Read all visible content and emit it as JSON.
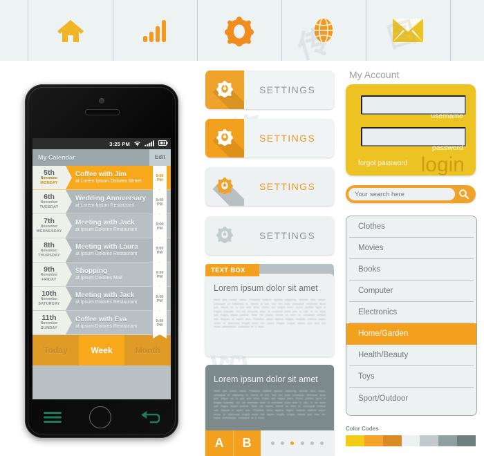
{
  "iconbar": {
    "icons": [
      {
        "name": "home-icon",
        "label": "Home",
        "color": "#f2b422"
      },
      {
        "name": "signal-bars-icon",
        "label": "Signal",
        "color": "#f09a20"
      },
      {
        "name": "gear-icon",
        "label": "Settings",
        "color": "#f18d1d"
      },
      {
        "name": "globe-icon",
        "label": "Globe",
        "color": "#f09a20"
      },
      {
        "name": "envelope-icon",
        "label": "Mail",
        "color": "#edc324"
      }
    ]
  },
  "phone": {
    "statusbar": {
      "time": "3:25 PM",
      "wifi": "wifi-icon",
      "signal": "signal-icon",
      "battery": "battery-icon"
    },
    "header": {
      "title": "My Calendar",
      "edit": "Edit"
    },
    "events": [
      {
        "day": "5th",
        "month": "November",
        "weekday": "MONDAY",
        "title": "Coffee with Jim",
        "place": "at Lorem Ipsum Dolores Street",
        "time1": "9:00",
        "time2": "PM",
        "state": "active"
      },
      {
        "day": "6th",
        "month": "November",
        "weekday": "TUESDAY",
        "title": "Wedding Anniversary",
        "place": "at Lorem Ipsum Restaurant",
        "time1": "9:00",
        "time2": "PM",
        "state": "alt"
      },
      {
        "day": "7th",
        "month": "November",
        "weekday": "WEDNESDAY",
        "title": "Meeting with Jack",
        "place": "at Ipsum Dolores Restaurant",
        "time1": "9:00",
        "time2": "PM",
        "state": "normal"
      },
      {
        "day": "8th",
        "month": "November",
        "weekday": "THURSDAY",
        "title": "Meeting with Laura",
        "place": "at Ipsum Dolores Restaurant",
        "time1": "9:00",
        "time2": "PM",
        "state": "alt"
      },
      {
        "day": "9th",
        "month": "November",
        "weekday": "FRIDAY",
        "title": "Shopping",
        "place": "at Ipsum Dolores Mall",
        "time1": "9:00",
        "time2": "PM",
        "state": "normal"
      },
      {
        "day": "10th",
        "month": "November",
        "weekday": "SATURDAY",
        "title": "Meeting with Jack",
        "place": "at Ipsum Dolores Restaurant",
        "time1": "9:00",
        "time2": "PM",
        "state": "alt"
      },
      {
        "day": "11th",
        "month": "November",
        "weekday": "SUNDAY",
        "title": "Coffee with Eva",
        "place": "at Ipsum Dolores Restaurant",
        "time1": "9:00",
        "time2": "PM",
        "state": "normal"
      }
    ],
    "segments": [
      {
        "label": "Today",
        "selected": false
      },
      {
        "label": "Week",
        "selected": true
      },
      {
        "label": "Month",
        "selected": false
      }
    ],
    "bottom": {
      "menu": "hamburger-menu-icon",
      "home": "home-button",
      "back": "back-arrow-icon"
    }
  },
  "settings_buttons": [
    {
      "label": "SETTINGS",
      "variant": "v1",
      "icon": "gear-icon"
    },
    {
      "label": "SETTINGS",
      "variant": "v2",
      "icon": "gear-icon"
    },
    {
      "label": "SETTINGS",
      "variant": "v3",
      "icon": "gear-icon"
    },
    {
      "label": "SETTINGS",
      "variant": "v4",
      "icon": "gear-icon"
    }
  ],
  "textbox": {
    "tab_label": "TEXT BOX",
    "heading": "Lorem ipsum dolor sit amet",
    "body": "Morbi quis cursus metus. Phasellus eleifend egestas adipiscing. Aenean risus neque, consequat eu adipiscing et, viverra at orci. Sed non justo consequat, bibendum lacus quis, aliquet mi. In quis ante tellus. Donec sed magna lorem. Donec porttitor ligula ut fringilla vulputate, orci est venenatis dolor, id commodo lorem ante ut odio. In vel turpis quis magna aliquet pulvinar. Nulla nisl mauris, blandit eu enim et, consequat tristique velit. Aliquam et sapien arcu. Phasellus varius dapibus magna, molestie eleifend sapien ornare at. Maecenas fringilla luctus non sapien fringilla congue. Mauris quis risus nec metus pellentesque consequat at a turpis."
  },
  "graycard": {
    "heading": "Lorem ipsum dolor sit amet",
    "body": "Morbi quis cursus metus. Phasellus eleifend egestas adipiscing. Aenean risus neque, consequat eu adipiscing et, viverra at orci. Sed non justo consequat, bibendum lacus quis, aliquet mi. In quis ante tellus. Donec sed magna lorem. Donec porttitor ligula ut fringilla vulputate, orci est venenatis dolor, id commodo lorem ante ut odio. In vel turpis quis magna aliquet pulvinar. Nulla nisl mauris, blandit eu enim et, consequat tristique velit. Aliquam et sapien arcu. Phasellus varius dapibus magna, molestie eleifend sapien ornare at. Maecenas fringilla luctus non sapien fringilla congue. Mauris quis risus nec metus pellentesque consequat at a turpis.",
    "button_a": "A",
    "button_b": "B",
    "dots": 6,
    "active_dot": 3
  },
  "account": {
    "title": "My Account",
    "username_value": "",
    "username_caption": "username",
    "password_value": "",
    "password_caption": "password",
    "forgot": "forgot password",
    "login": "login"
  },
  "search": {
    "placeholder": "Your search here",
    "value": "",
    "icon": "search-icon"
  },
  "categories": {
    "items": [
      {
        "label": "Clothes",
        "selected": false
      },
      {
        "label": "Movies",
        "selected": false
      },
      {
        "label": "Books",
        "selected": false
      },
      {
        "label": "Computer",
        "selected": false
      },
      {
        "label": "Electronics",
        "selected": false
      },
      {
        "label": "Home/Garden",
        "selected": true
      },
      {
        "label": "Health/Beauty",
        "selected": false
      },
      {
        "label": "Toys",
        "selected": false
      },
      {
        "label": "Sport/Outdoor",
        "selected": false
      }
    ]
  },
  "color_codes": {
    "title": "Color Codes",
    "swatches": [
      "#f2cd16",
      "#f4a22a",
      "#d98a25",
      "#eef1f2",
      "#c3cace",
      "#8fa0a2",
      "#6e7d7e"
    ]
  }
}
